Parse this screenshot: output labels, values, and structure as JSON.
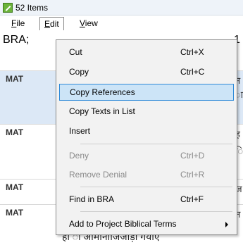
{
  "window": {
    "title": "52 Items"
  },
  "menubar": {
    "file": "File",
    "edit": "Edit",
    "view": "View"
  },
  "content": {
    "header": "BRA;",
    "header_right": "1",
    "rows": [
      {
        "label": "MAT"
      },
      {
        "label": "MAT"
      },
      {
        "label": "MAT"
      },
      {
        "label": "MAT"
      }
    ],
    "bottom_text": "हा ा आमानाजिजोड़ा गयाए"
  },
  "menu": {
    "items": [
      {
        "label": "Cut",
        "shortcut": "Ctrl+X"
      },
      {
        "label": "Copy",
        "shortcut": "Ctrl+C"
      },
      {
        "label": "Copy References",
        "shortcut": ""
      },
      {
        "label": "Copy Texts in List",
        "shortcut": ""
      },
      {
        "label": "Insert",
        "shortcut": ""
      },
      {
        "label": "Deny",
        "shortcut": "Ctrl+D"
      },
      {
        "label": "Remove Denial",
        "shortcut": "Ctrl+R"
      },
      {
        "label": "Find in BRA",
        "shortcut": "Ctrl+F"
      },
      {
        "label": "Add to Project Biblical Terms",
        "shortcut": ""
      }
    ]
  },
  "colors": {
    "highlight": "#cce4f7",
    "highlight_border": "#2e8ad8",
    "menu_bg": "#f2f2f2",
    "disabled_text": "#8a8a8a",
    "selected_row": "#dce8f6"
  },
  "icons": {
    "app": "green-checkmark-icon",
    "submenu": "chevron-right-icon"
  }
}
